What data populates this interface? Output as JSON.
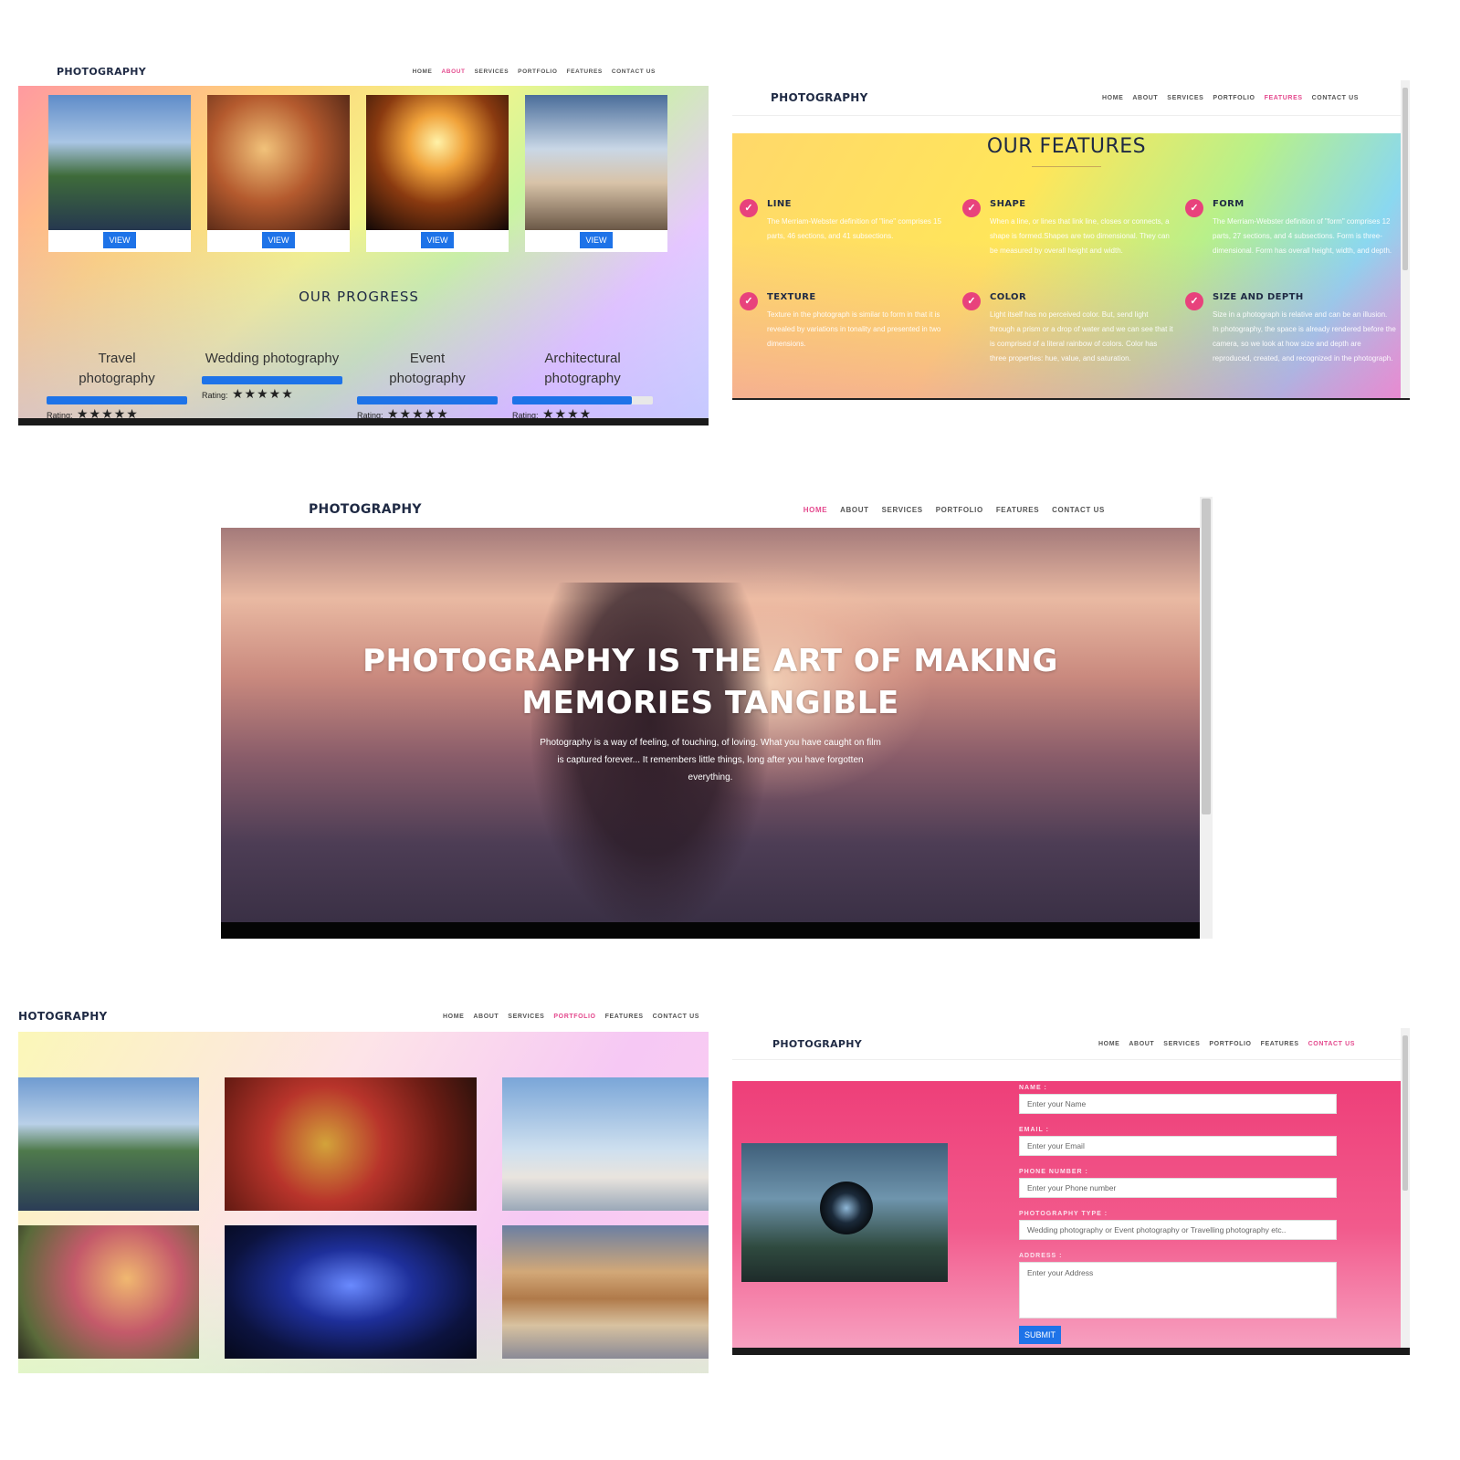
{
  "brand": "PHOTOGRAPHY",
  "brand_cropped": "HOTOGRAPHY",
  "nav": [
    "HOME",
    "ABOUT",
    "SERVICES",
    "PORTFOLIO",
    "FEATURES",
    "CONTACT US"
  ],
  "about": {
    "view_label": "VIEW",
    "progress_title": "OUR PROGRESS",
    "rating_label": "Rating:",
    "items": [
      {
        "line1": "Travel",
        "line2": "photography",
        "progress": 100,
        "stars": "★★★★★"
      },
      {
        "line1": "Wedding photography",
        "line2": "",
        "progress": 100,
        "stars": "★★★★★"
      },
      {
        "line1": "Event",
        "line2": "photography",
        "progress": 100,
        "stars": "★★★★★"
      },
      {
        "line1": "Architectural",
        "line2": "photography",
        "progress": 85,
        "stars": "★★★★"
      }
    ]
  },
  "features": {
    "title": "OUR FEATURES",
    "items": [
      {
        "title": "LINE",
        "text": "The Merriam-Webster definition of \"line\" comprises 15 parts, 46 sections, and 41 subsections."
      },
      {
        "title": "SHAPE",
        "text": "When a line, or lines that link line, closes or connects, a shape is formed.Shapes are two dimensional. They can be measured by overall height and width."
      },
      {
        "title": "FORM",
        "text": "The Merriam-Webster definition of \"form\" comprises 12 parts, 27 sections, and 4 subsections. Form is three-dimensional. Form has overall height, width, and depth."
      },
      {
        "title": "TEXTURE",
        "text": "Texture in the photograph is similar to form in that it is revealed by variations in tonality and presented in two dimensions."
      },
      {
        "title": "COLOR",
        "text": "Light itself has no perceived color. But, send light through a prism or a drop of water and we can see that it is comprised of a literal rainbow of colors. Color has three properties: hue, value, and saturation."
      },
      {
        "title": "SIZE AND DEPTH",
        "text": "Size in a photograph is relative and can be an illusion.",
        "text2": "In photography, the space is already rendered before the camera, so we look at how size and depth are reproduced, created, and recognized in the photograph."
      }
    ]
  },
  "hero": {
    "line1": "PHOTOGRAPHY IS THE ART OF MAKING",
    "line2": "MEMORIES TANGIBLE",
    "sub1": "Photography is a way of feeling, of touching, of loving. What you have caught on film",
    "sub2": "is captured forever... It remembers little things, long after you have forgotten",
    "sub3": "everything."
  },
  "contact": {
    "fields": [
      {
        "label": "NAME :",
        "placeholder": "Enter your Name"
      },
      {
        "label": "EMAIL :",
        "placeholder": "Enter your Email"
      },
      {
        "label": "PHONE NUMBER :",
        "placeholder": "Enter your Phone number"
      },
      {
        "label": "PHOTOGRAPHY TYPE :",
        "placeholder": "Wedding photography or Event photography or Travelling photography etc.."
      },
      {
        "label": "ADDRESS :",
        "placeholder": "Enter your Address"
      }
    ],
    "submit": "SUBMIT"
  },
  "colors": {
    "brand": "#1f2a44",
    "active": "#e44a8e",
    "button": "#1e73e8",
    "check": "#e8427c"
  }
}
